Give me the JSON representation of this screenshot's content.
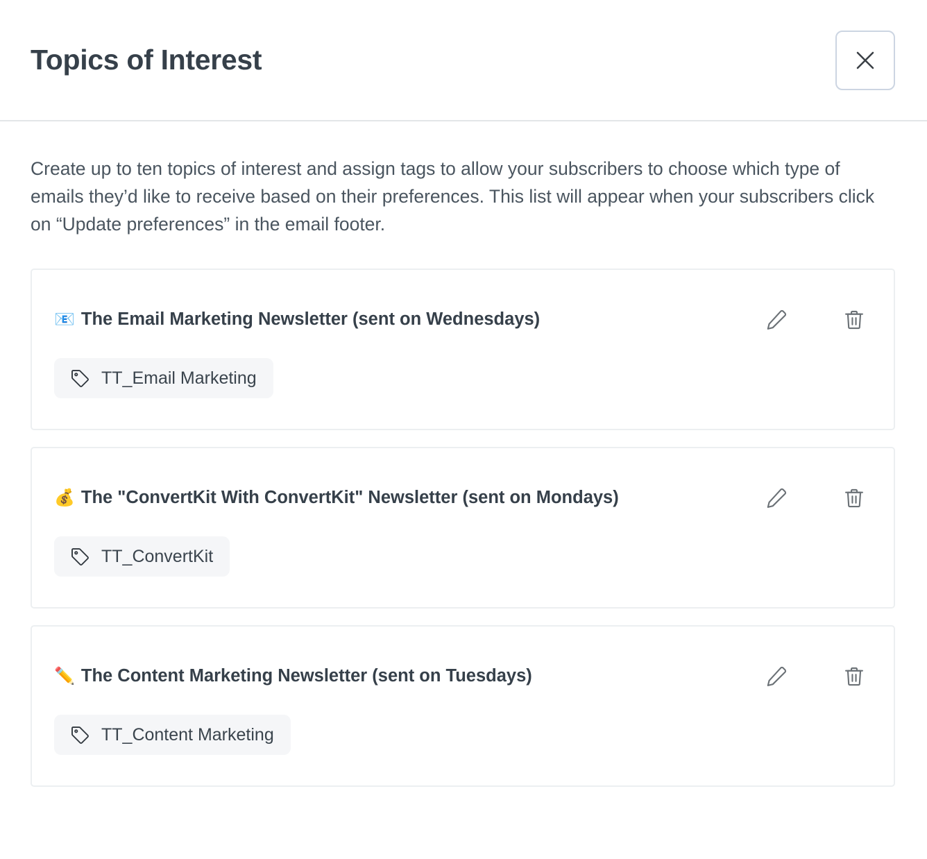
{
  "header": {
    "title": "Topics of Interest",
    "close_label": "Close",
    "close_icon": "close-icon"
  },
  "body": {
    "description": "Create up to ten topics of interest and assign tags to allow your subscribers to choose which type of emails they’d like to receive based on their preferences. This list will appear when your subscribers click on “Update preferences” in the email footer."
  },
  "topics": [
    {
      "emoji": "📧",
      "emoji_name": "e-mail-emoji",
      "title": "The Email Marketing Newsletter (sent on Wednesdays)",
      "tags": [
        {
          "label": "TT_Email Marketing",
          "icon": "tag-icon"
        }
      ],
      "edit_label": "Edit",
      "delete_label": "Delete"
    },
    {
      "emoji": "💰",
      "emoji_name": "money-bag-emoji",
      "title": "The \"ConvertKit With ConvertKit\" Newsletter (sent on Mondays)",
      "tags": [
        {
          "label": "TT_ConvertKit",
          "icon": "tag-icon"
        }
      ],
      "edit_label": "Edit",
      "delete_label": "Delete"
    },
    {
      "emoji": "✏️",
      "emoji_name": "pencil-emoji",
      "title": "The Content Marketing Newsletter (sent on Tuesdays)",
      "tags": [
        {
          "label": "TT_Content Marketing",
          "icon": "tag-icon"
        }
      ],
      "edit_label": "Edit",
      "delete_label": "Delete"
    }
  ],
  "colors": {
    "text": "#36404a",
    "muted_text": "#4a555f",
    "card_border": "#eceff1",
    "header_divider": "#e3e6e8",
    "close_border": "#ccd5e2",
    "tag_background": "#f5f6f8",
    "icon_stroke": "#6b7176"
  }
}
